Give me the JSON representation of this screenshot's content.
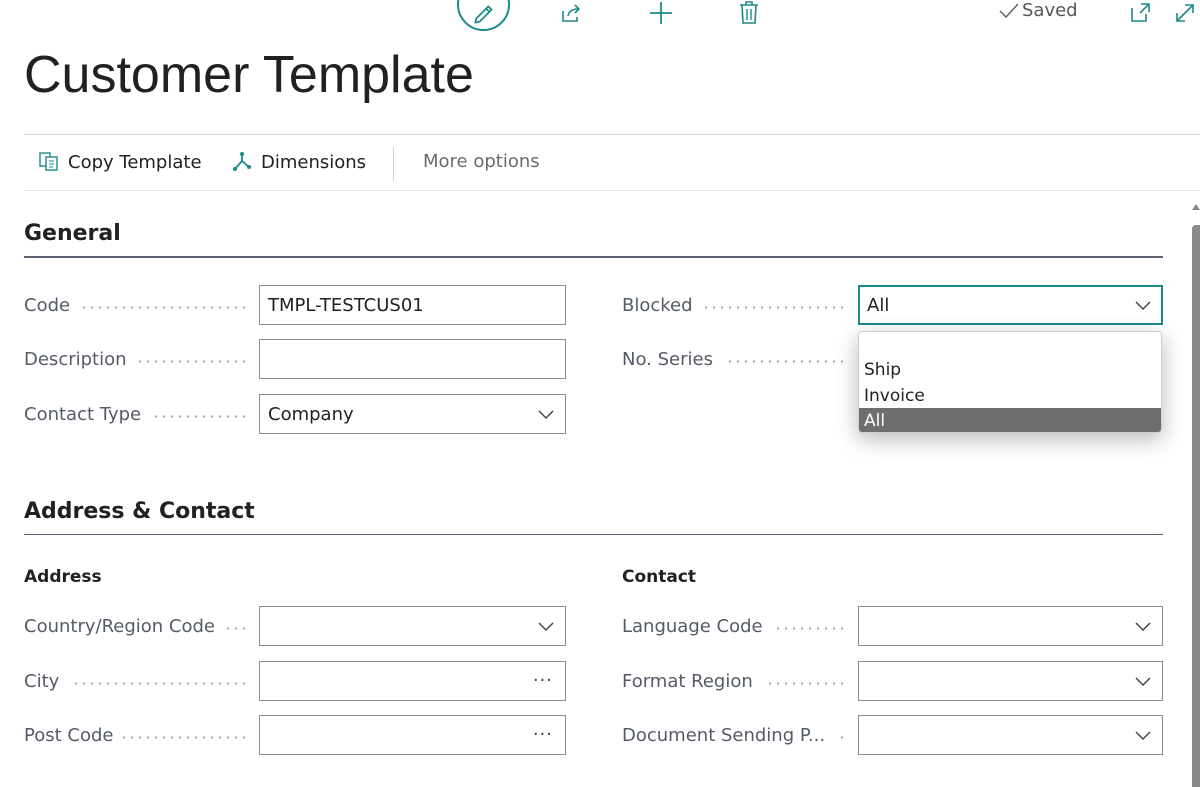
{
  "header": {
    "saved_label": "Saved",
    "title": "Customer Template"
  },
  "icons": {
    "edit": "pencil-icon",
    "share": "share-icon",
    "add": "plus-icon",
    "delete": "trash-icon",
    "open_new": "open-in-new-window-icon",
    "expand": "expand-icon"
  },
  "actions": {
    "copy_template": "Copy Template",
    "dimensions": "Dimensions",
    "more_options": "More options"
  },
  "general": {
    "title": "General",
    "code_label": "Code",
    "code_value": "TMPL-TESTCUS01",
    "description_label": "Description",
    "description_value": "",
    "contact_type_label": "Contact Type",
    "contact_type_value": "Company",
    "blocked_label": "Blocked",
    "blocked_value": "All",
    "no_series_label": "No. Series",
    "blocked_options": [
      "",
      "Ship",
      "Invoice",
      "All"
    ],
    "blocked_selected": "All"
  },
  "address_contact": {
    "title": "Address & Contact",
    "address_heading": "Address",
    "contact_heading": "Contact",
    "country_label": "Country/Region Code",
    "city_label": "City",
    "post_code_label": "Post Code",
    "language_label": "Language Code",
    "format_region_label": "Format Region",
    "document_sending_label": "Document Sending P..."
  },
  "colors": {
    "accent": "#1b8a88",
    "selected_option_bg": "#6e6e6e",
    "section_rule": "#5b6170"
  }
}
